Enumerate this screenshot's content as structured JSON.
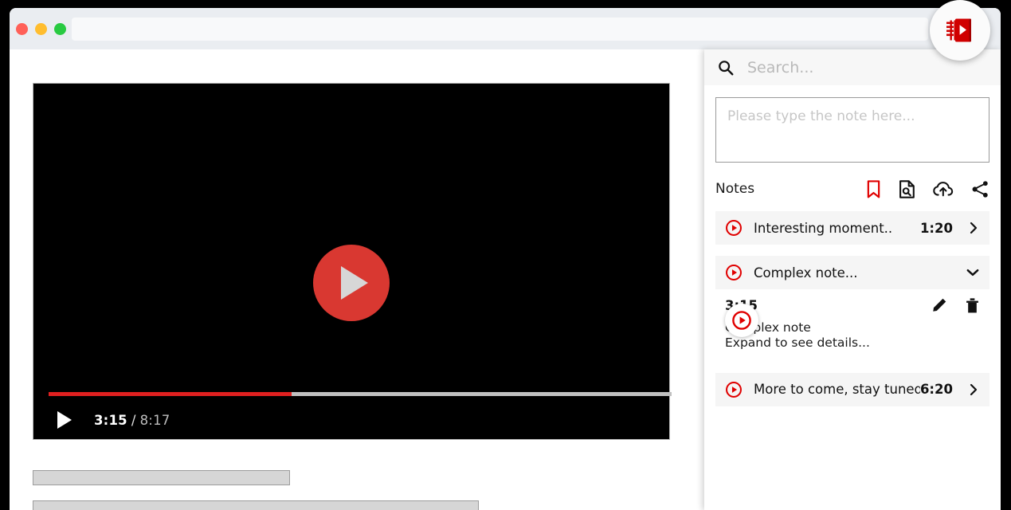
{
  "window": {
    "traffic_lights": [
      "close",
      "minimize",
      "maximize"
    ],
    "url_value": "",
    "url_placeholder": ""
  },
  "badge": {
    "name": "extension-logo",
    "label": "Video Notes",
    "color": "#d00000"
  },
  "video": {
    "current_time": "3:15",
    "duration": "8:17",
    "separator": "/",
    "progress_percent": 39,
    "play_button_label": "Play",
    "big_play_label": "Play video",
    "accent": "#d93831",
    "progress_color": "#e02020"
  },
  "placeholders": {
    "bar_one": "",
    "bar_two": ""
  },
  "sidebar": {
    "search": {
      "placeholder": "Search...",
      "value": ""
    },
    "note_input": {
      "placeholder": "Please type the note here...",
      "value": ""
    },
    "notes_header": {
      "title": "Notes",
      "actions": [
        {
          "name": "bookmark-icon",
          "label": "Bookmark",
          "color": "#e00000"
        },
        {
          "name": "document-search-icon",
          "label": "Export notes",
          "color": "#111111"
        },
        {
          "name": "cloud-upload-icon",
          "label": "Sync to cloud",
          "color": "#111111"
        },
        {
          "name": "share-icon",
          "label": "Share",
          "color": "#111111"
        }
      ]
    },
    "notes": [
      {
        "title": "Interesting moment..",
        "time": "1:20",
        "expanded": false,
        "chevron": "right"
      },
      {
        "title": "Complex note...",
        "time": "3:15",
        "expanded": true,
        "chevron": "down",
        "detail_time": "3:15",
        "detail_body": "Complex note\nExpand to see details...",
        "edit_label": "Edit",
        "delete_label": "Delete"
      },
      {
        "title": "More to come, stay tuned!",
        "time": "6:20",
        "expanded": false,
        "chevron": "right"
      }
    ]
  }
}
